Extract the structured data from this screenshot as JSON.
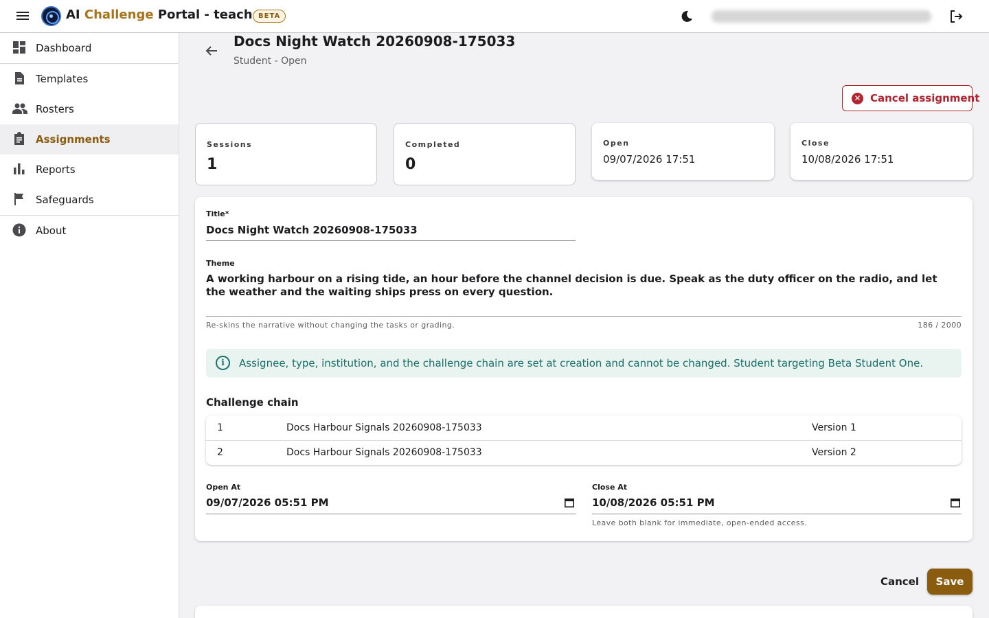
{
  "header": {
    "app_title_prefix": "AI ",
    "app_title_accent": "Challenge",
    "app_title_suffix": " Portal - teacher",
    "beta_badge": "BETA",
    "icons": {
      "menu": "menu-icon",
      "theme": "moon-icon",
      "logout": "logout-icon"
    }
  },
  "sidebar": {
    "items": [
      {
        "label": "Dashboard",
        "icon": "dashboard-icon",
        "active": false
      },
      {
        "label": "Templates",
        "icon": "document-icon",
        "active": false
      },
      {
        "label": "Rosters",
        "icon": "people-icon",
        "active": false
      },
      {
        "label": "Assignments",
        "icon": "clipboard-icon",
        "active": true
      },
      {
        "label": "Reports",
        "icon": "bar-chart-icon",
        "active": false
      },
      {
        "label": "Safeguards",
        "icon": "flag-icon",
        "active": false
      },
      {
        "label": "About",
        "icon": "info-icon",
        "active": false
      }
    ]
  },
  "page": {
    "title": "Docs Night Watch 20260908-175033",
    "subtitle": "Student - Open",
    "cancel_assignment": "Cancel assignment"
  },
  "stats": {
    "sessions": {
      "label": "Sessions",
      "value": "1"
    },
    "completed": {
      "label": "Completed",
      "value": "0"
    },
    "open": {
      "label": "Open",
      "value": "09/07/2026 17:51"
    },
    "close": {
      "label": "Close",
      "value": "10/08/2026 17:51"
    }
  },
  "form": {
    "title_label": "Title*",
    "title_value": "Docs Night Watch 20260908-175033",
    "theme_label": "Theme",
    "theme_value": "A working harbour on a rising tide, an hour before the channel decision is due. Speak as the duty officer on the radio, and let the weather and the waiting ships press on every question.",
    "theme_helper": "Re-skins the narrative without changing the tasks or grading.",
    "theme_counter": "186 / 2000",
    "info_text": "Assignee, type, institution, and the challenge chain are set at creation and cannot be changed. Student targeting Beta Student One.",
    "chain_label": "Challenge chain",
    "chain": [
      {
        "index": "1",
        "name": "Docs Harbour Signals 20260908-175033",
        "version": "Version 1"
      },
      {
        "index": "2",
        "name": "Docs Harbour Signals 20260908-175033",
        "version": "Version 2"
      }
    ],
    "open_at_label": "Open At",
    "open_at_value": "09/07/2026 05:51 PM",
    "close_at_label": "Close At",
    "close_at_value": "10/08/2026 05:51 PM",
    "dates_helper": "Leave both blank for immediate, open-ended access."
  },
  "actions": {
    "cancel": "Cancel",
    "save": "Save"
  },
  "colors": {
    "accent": "#8a5c10",
    "danger": "#b0252f",
    "info": "#1a6e69"
  }
}
